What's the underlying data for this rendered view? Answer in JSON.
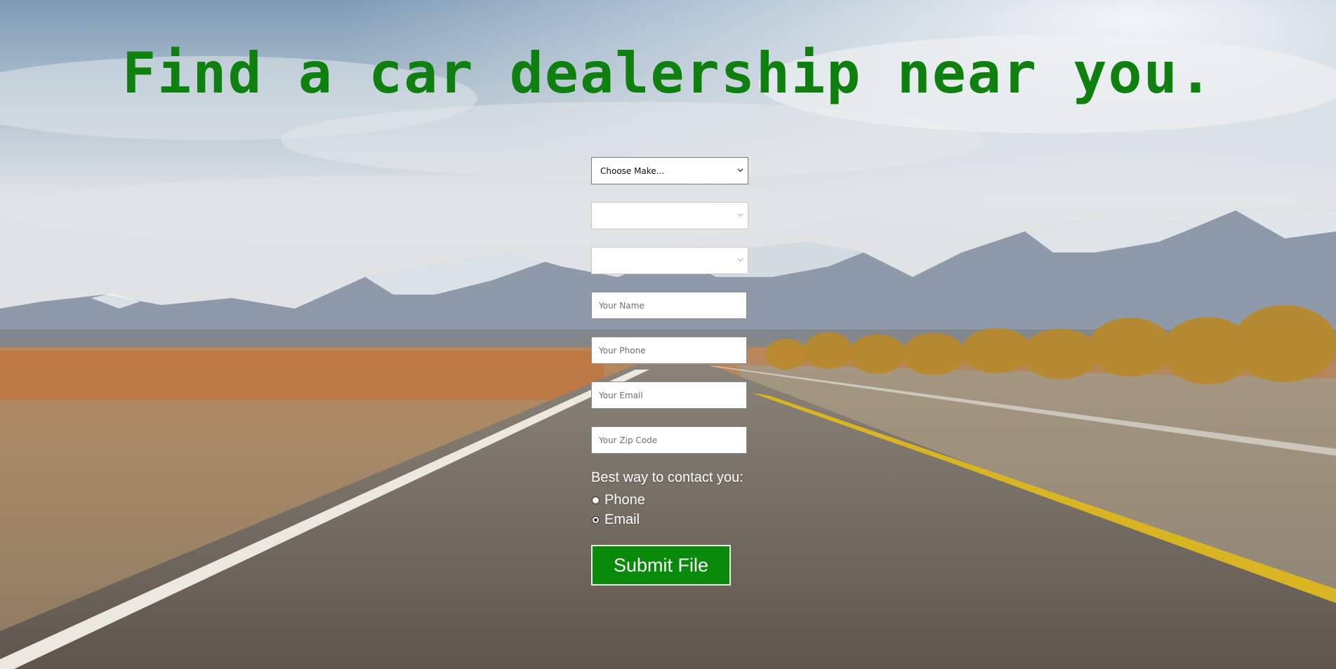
{
  "page": {
    "headline": "Find a car dealership near you."
  },
  "form": {
    "make_select": {
      "value": "Choose Make..."
    },
    "model_select": {
      "value": ""
    },
    "year_select": {
      "value": ""
    },
    "name_input": {
      "value": "",
      "placeholder": "Your Name"
    },
    "phone_input": {
      "value": "",
      "placeholder": "Your Phone"
    },
    "email_input": {
      "value": "",
      "placeholder": "Your Email"
    },
    "zip_input": {
      "value": "",
      "placeholder": "Your Zip Code"
    },
    "contact": {
      "title": "Best way to contact you:",
      "options": [
        {
          "label": "Phone",
          "checked": false
        },
        {
          "label": "Email",
          "checked": true
        }
      ]
    },
    "submit_label": "Submit File"
  },
  "colors": {
    "accent_green": "#0a8a0a",
    "headline_green": "#0f7f0f"
  }
}
